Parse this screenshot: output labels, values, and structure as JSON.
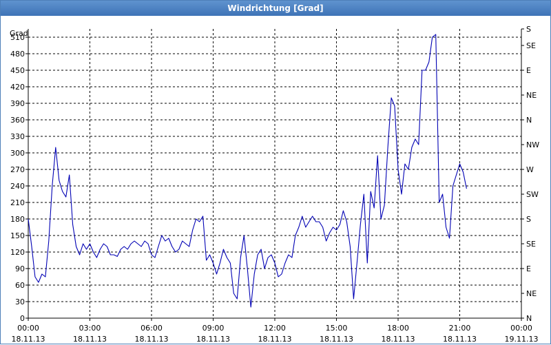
{
  "window": {
    "title": "Windrichtung [Grad]"
  },
  "chart_data": {
    "type": "line",
    "title": "Windrichtung [Grad]",
    "ylabel": "Grad",
    "ylim": [
      0,
      525
    ],
    "grid": true,
    "series": [
      {
        "color": "#0000b4",
        "x_minutes": [
          0,
          10,
          20,
          30,
          40,
          50,
          60,
          70,
          80,
          90,
          100,
          110,
          120,
          130,
          140,
          150,
          160,
          170,
          180,
          190,
          200,
          210,
          220,
          230,
          240,
          250,
          260,
          270,
          280,
          290,
          300,
          310,
          320,
          330,
          340,
          350,
          360,
          370,
          380,
          390,
          400,
          410,
          420,
          430,
          440,
          450,
          460,
          470,
          480,
          490,
          500,
          510,
          520,
          530,
          540,
          550,
          560,
          570,
          580,
          590,
          600,
          610,
          620,
          630,
          640,
          650,
          660,
          670,
          680,
          690,
          700,
          710,
          720,
          730,
          740,
          750,
          760,
          770,
          780,
          790,
          800,
          810,
          820,
          830,
          840,
          850,
          860,
          870,
          880,
          890,
          900,
          910,
          920,
          930,
          940,
          950,
          960,
          970,
          980,
          990,
          1000,
          1010,
          1020,
          1030,
          1040,
          1050,
          1060,
          1070,
          1080,
          1090,
          1100,
          1110,
          1120,
          1130,
          1140,
          1150,
          1160,
          1170,
          1180,
          1190,
          1200,
          1210,
          1220,
          1230,
          1240,
          1250,
          1260,
          1270,
          1280,
          1290,
          1300,
          1310,
          1320,
          1330,
          1340,
          1350,
          1360,
          1370,
          1380,
          1390,
          1400,
          1410,
          1420,
          1430
        ],
        "values": [
          180,
          130,
          75,
          65,
          80,
          75,
          140,
          240,
          310,
          250,
          230,
          220,
          260,
          170,
          130,
          115,
          135,
          125,
          135,
          120,
          110,
          125,
          135,
          130,
          115,
          115,
          112,
          125,
          130,
          125,
          135,
          140,
          135,
          130,
          140,
          135,
          115,
          110,
          130,
          150,
          140,
          145,
          130,
          120,
          125,
          140,
          135,
          130,
          160,
          180,
          175,
          185,
          105,
          115,
          100,
          80,
          100,
          125,
          110,
          100,
          45,
          35,
          110,
          150,
          90,
          20,
          80,
          115,
          125,
          90,
          110,
          115,
          100,
          75,
          80,
          100,
          115,
          110,
          150,
          165,
          185,
          165,
          175,
          185,
          175,
          175,
          165,
          140,
          155,
          165,
          160,
          170,
          195,
          175,
          130,
          35,
          100,
          170,
          225,
          100,
          230,
          200,
          295,
          180,
          205,
          310,
          400,
          385,
          270,
          225,
          280,
          270,
          310,
          325,
          315,
          450,
          450,
          465,
          510,
          515,
          210,
          225,
          165,
          145,
          240,
          260,
          280,
          265,
          235
        ]
      }
    ],
    "x_tick_times": [
      "00:00",
      "03:00",
      "06:00",
      "09:00",
      "12:00",
      "15:00",
      "18:00",
      "21:00",
      "00:00"
    ],
    "x_tick_dates": [
      "18.11.13",
      "18.11.13",
      "18.11.13",
      "18.11.13",
      "18.11.13",
      "18.11.13",
      "18.11.13",
      "18.11.13",
      "19.11.13"
    ],
    "y_ticks_left": [
      510,
      480,
      450,
      420,
      390,
      360,
      330,
      300,
      270,
      240,
      210,
      180,
      150,
      120,
      90,
      60,
      30,
      0
    ],
    "y_ticks_right": [
      {
        "value": 525,
        "label": "S"
      },
      {
        "value": 495,
        "label": "SE"
      },
      {
        "value": 450,
        "label": "E"
      },
      {
        "value": 405,
        "label": "NE"
      },
      {
        "value": 360,
        "label": "N"
      },
      {
        "value": 315,
        "label": "NW"
      },
      {
        "value": 270,
        "label": "W"
      },
      {
        "value": 225,
        "label": "SW"
      },
      {
        "value": 180,
        "label": "S"
      },
      {
        "value": 135,
        "label": "SE"
      },
      {
        "value": 90,
        "label": "E"
      },
      {
        "value": 45,
        "label": "NE"
      },
      {
        "value": 0,
        "label": "N"
      }
    ]
  }
}
